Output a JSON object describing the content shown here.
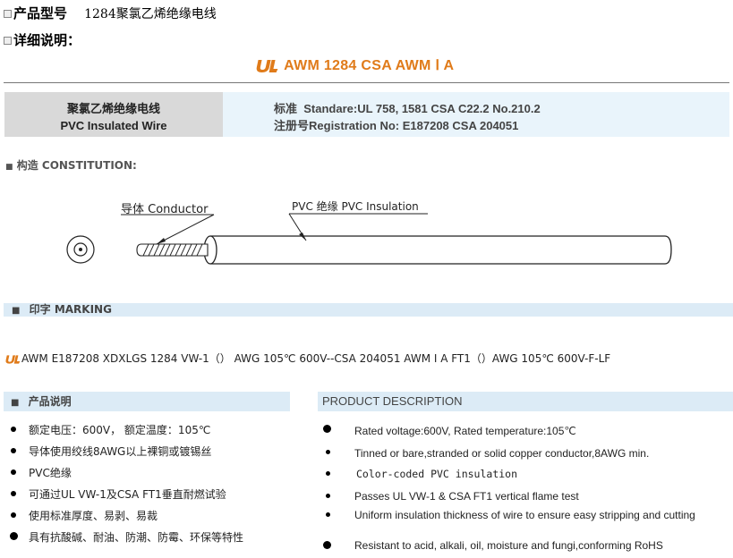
{
  "header": {
    "product_model_label": "产品型号",
    "product_model_value": "1284聚氯乙烯绝缘电线",
    "detail_label": "详细说明："
  },
  "title": {
    "text": "AWM 1284 CSA AWM Ⅰ A",
    "logo_name": "ul-recognized-logo",
    "color": "#e07b1a"
  },
  "info": {
    "name_cn": "聚氯乙烯绝缘电线",
    "name_en": "PVC Insulated Wire",
    "standard_label": "标准",
    "standard_value": "Standare:UL 758, 1581 CSA C22.2 No.210.2",
    "registration_label": "注册号",
    "registration_value": "Registration No: E187208 CSA 204051"
  },
  "construction": {
    "heading": "构造  CONSTITUTION:",
    "conductor_label": "导体 Conductor",
    "insulation_label": "PVC 绝缘 PVC Insulation"
  },
  "marking": {
    "heading": "印字 MARKING",
    "text": "AWM E187208 XDXLGS 1284 VW-1（）  AWG 105℃ 600V--CSA 204051 AWM I A FT1（）AWG 105℃ 600V-F-LF"
  },
  "desc_cn": {
    "heading": "产品说明",
    "items": [
      "额定电压：600V， 额定温度：105℃",
      "导体使用绞线8AWG以上裸铜或镀锡丝",
      "PVC绝缘",
      "可通过UL VW-1及CSA FT1垂直耐燃试验",
      "使用标准厚度、易剥、易裁",
      "具有抗酸碱、耐油、防潮、防霉、环保等特性"
    ]
  },
  "desc_en": {
    "heading": "PRODUCT DESCRIPTION",
    "items": [
      "Rated voltage:600V, Rated temperature:105℃",
      "Tinned or bare,stranded or solid copper conductor,8AWG min.",
      "Color-coded PVC insulation",
      "Passes UL VW-1 & CSA FT1 vertical flame test",
      "Uniform insulation thickness of wire to ensure easy stripping and cutting",
      "Resistant to acid, alkali, oil, moisture and fungi,conforming RoHS"
    ]
  },
  "colors": {
    "accent_orange": "#e07b1a",
    "section_bar_bg": "#dcebf6",
    "info_left_bg": "#d9d9d9",
    "info_right_bg": "#e9f4fb"
  }
}
